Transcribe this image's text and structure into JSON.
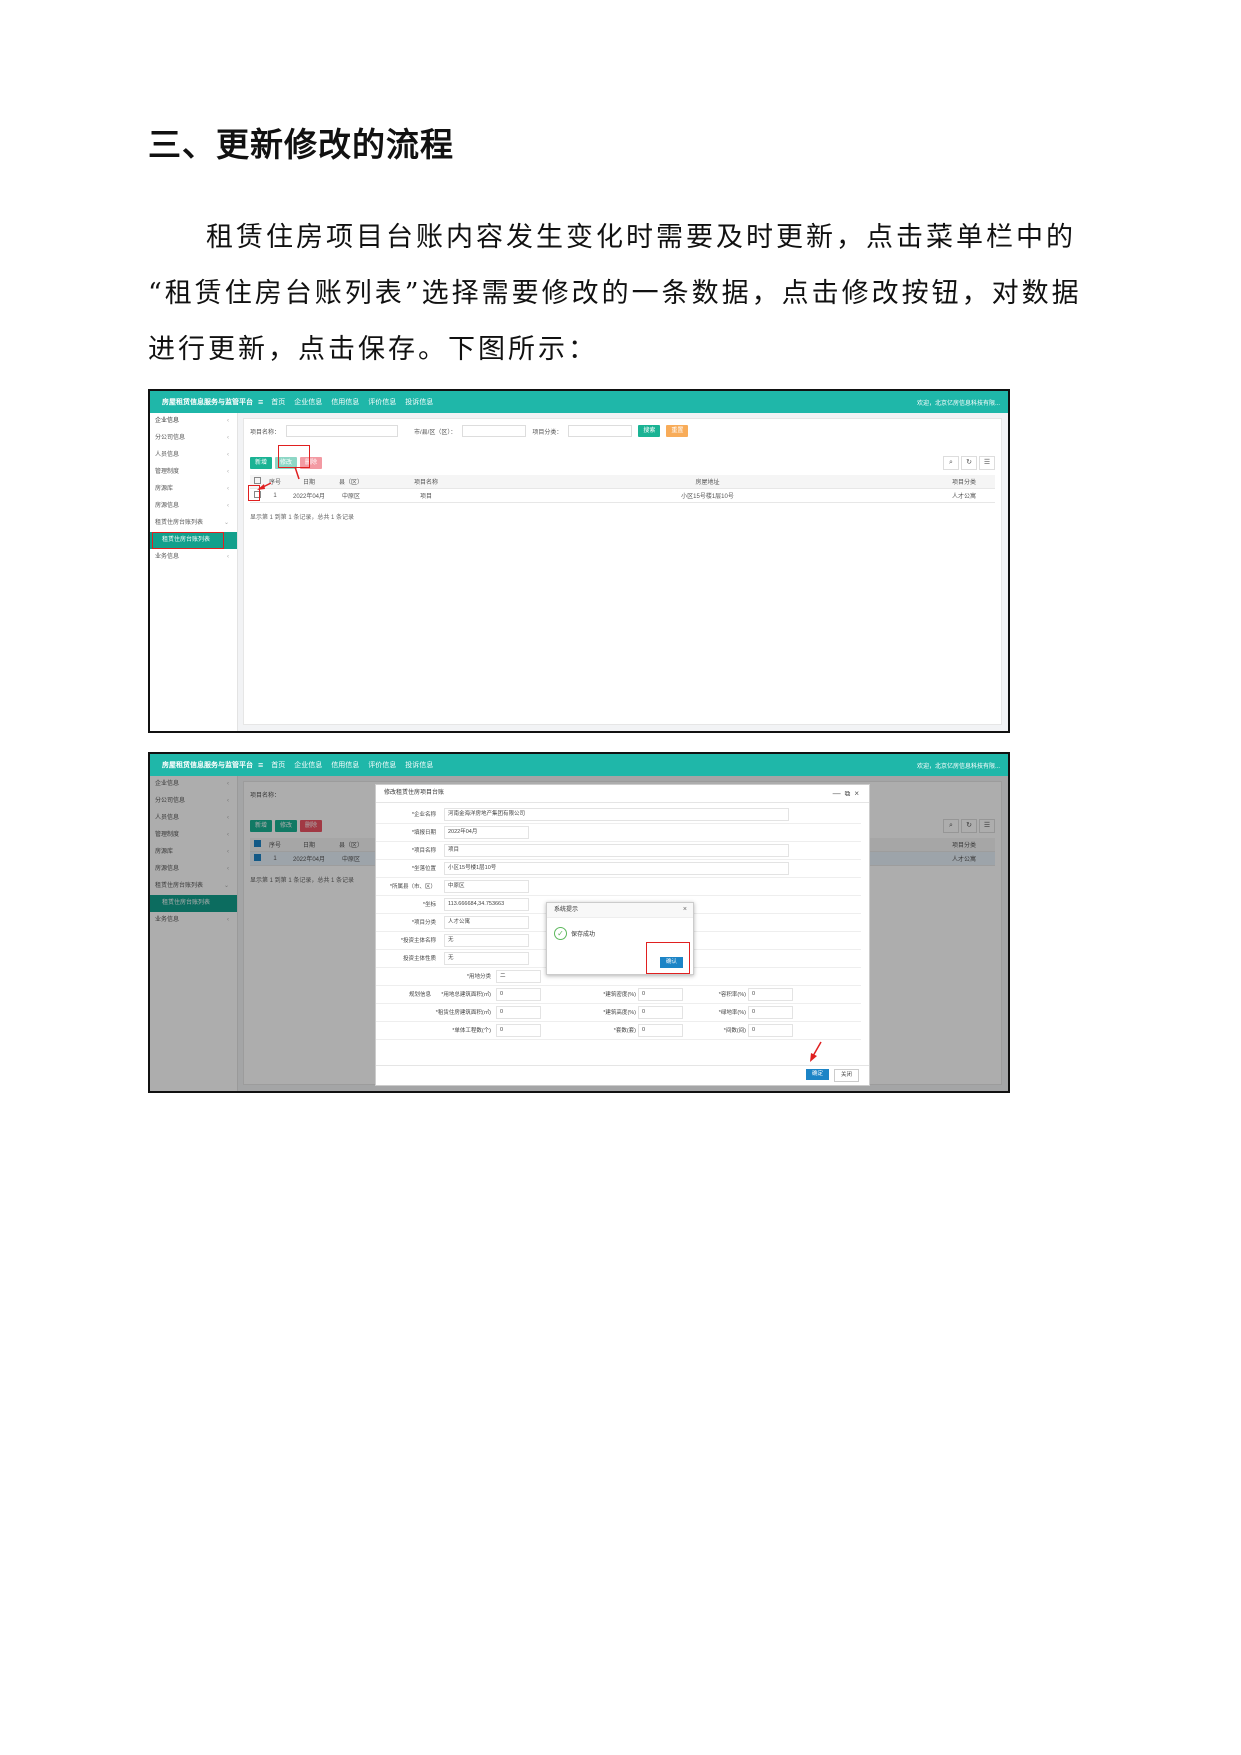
{
  "heading": "三、更新修改的流程",
  "paragraph": {
    "line1": "租赁住房项目台账内容发生变化时需要及时更新，点击菜单栏中的",
    "line2": "“租赁住房台账列表”选择需要修改的一条数据，点击修改按钮，对数据",
    "line3": "进行更新，点击保存。下图所示："
  },
  "app": {
    "brand": "房屋租赁信息服务与监管平台",
    "menu_icon": "≡",
    "nav": [
      "首页",
      "企业信息",
      "信用信息",
      "评价信息",
      "投诉信息"
    ],
    "welcome": "欢迎，北京亿房信息科技有限..."
  },
  "sidebar": [
    {
      "label": "企业信息",
      "icon": "doc-icon"
    },
    {
      "label": "分公司信息",
      "icon": "branch-icon"
    },
    {
      "label": "人员信息",
      "icon": "card-icon"
    },
    {
      "label": "管理制度",
      "icon": "list-icon"
    },
    {
      "label": "房源库",
      "icon": "monitor-icon"
    },
    {
      "label": "房源信息",
      "icon": "doc-icon"
    },
    {
      "label": "租赁住房台账列表",
      "icon": "doc-icon"
    },
    {
      "label": "租赁住房台账列表",
      "icon": ""
    },
    {
      "label": "业务信息",
      "icon": "user-icon"
    }
  ],
  "search": {
    "project_name_label": "项目名称：",
    "district_label": "市/县/区（区）：",
    "category_label": "项目分类：",
    "search_btn": "搜索",
    "reset_btn": "重置"
  },
  "toolbar": {
    "add": "新增",
    "edit": "修改",
    "delete": "删除"
  },
  "table": {
    "headers": [
      "序号",
      "日期",
      "县（区）",
      "项目名称",
      "房屋地址",
      "项目分类"
    ],
    "row": {
      "index": "1",
      "date": "2022年04月",
      "district": "中原区",
      "name": "项目",
      "address": "小区15号楼1层10号",
      "category": "人才公寓"
    }
  },
  "pagination_info": "显示第 1 到第 1 条记录，总共 1 条记录",
  "dialog": {
    "title": "修改租赁住房项目台账",
    "fields": [
      {
        "label": "*企业名称",
        "value": "河南金海洋房地产集团有限公司"
      },
      {
        "label": "*填报日期",
        "value": "2022年04月"
      },
      {
        "label": "*项目名称",
        "value": "项目"
      },
      {
        "label": "*坐落位置",
        "value": "小区15号楼1层10号"
      },
      {
        "label": "*所属县（市、区）",
        "value": "中原区"
      },
      {
        "label": "*坐标",
        "value": "113.666684,34.753663"
      },
      {
        "label": "*项目分类",
        "value": "人才公寓"
      },
      {
        "label": "*投资主体名称",
        "value": "无"
      },
      {
        "label": "投资主体性质",
        "value": "无"
      }
    ],
    "extra": {
      "section": "规划信息",
      "r0": {
        "label": "*用地分类",
        "value": "二"
      },
      "r1": [
        {
          "label": "*用地总建筑面积(㎡)",
          "value": "0"
        },
        {
          "label": "*建筑密度(%)",
          "value": "0"
        },
        {
          "label": "*容积率(%)",
          "value": "0"
        }
      ],
      "r2": [
        {
          "label": "*租赁住房建筑面积(㎡)",
          "value": "0"
        },
        {
          "label": "*建筑高度(%)",
          "value": "0"
        },
        {
          "label": "*绿地率(%)",
          "value": "0"
        }
      ],
      "r3": [
        {
          "label": "*单体工程数(个)",
          "value": "0"
        },
        {
          "label": "*套数(套)",
          "value": "0"
        },
        {
          "label": "*间数(间)",
          "value": "0"
        }
      ]
    },
    "save_btn": "确定",
    "close_btn": "关闭"
  },
  "message": {
    "title": "系统提示",
    "text": "保存成功",
    "ok": "确认"
  },
  "colors": {
    "primary": "#1fb7a9",
    "sidebar_active": "#12a08c",
    "highlight": "#e02020",
    "blue_btn": "#1c84c6"
  }
}
